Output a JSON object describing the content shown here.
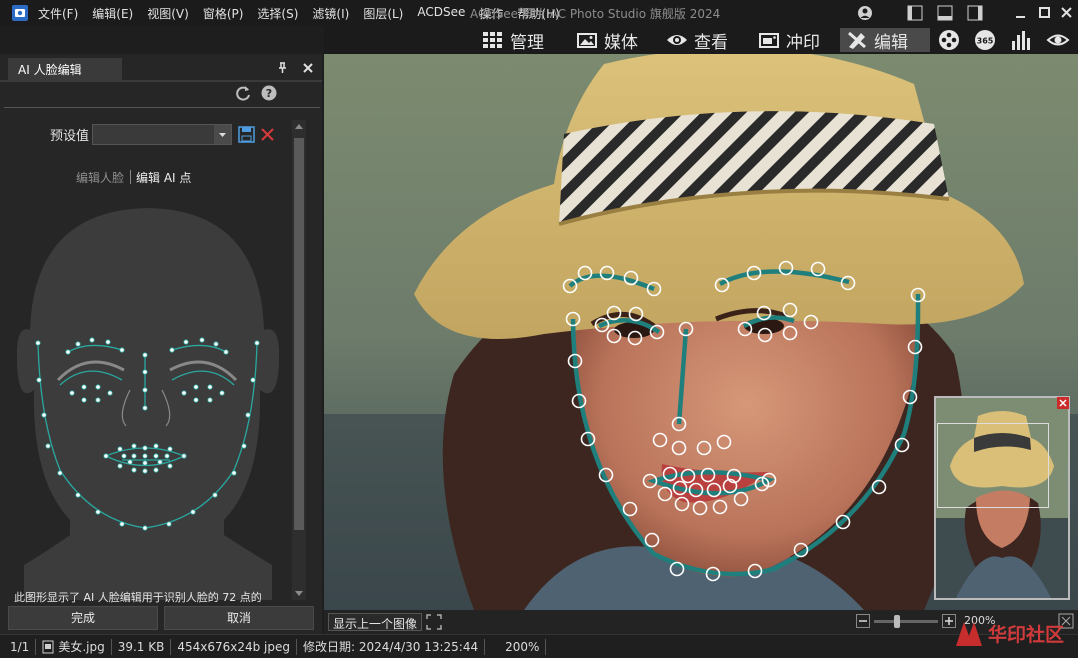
{
  "app": {
    "title": "ACDSee 照片 AC Photo Studio 旗舰版 2024",
    "menu": [
      "文件(F)",
      "编辑(E)",
      "视图(V)",
      "窗格(P)",
      "选择(S)",
      "滤镜(I)",
      "图层(L)",
      "ACDSee",
      "操作",
      "帮助(H)"
    ]
  },
  "modes": [
    {
      "label": "管理",
      "icon": "grid-icon"
    },
    {
      "label": "媒体",
      "icon": "photo-icon"
    },
    {
      "label": "查看",
      "icon": "eye-icon"
    },
    {
      "label": "冲印",
      "icon": "develop-icon"
    },
    {
      "label": "编辑",
      "icon": "edit-icon",
      "active": true
    }
  ],
  "panel": {
    "tab": "AI 人脸编辑",
    "preset_label": "预设值",
    "preset_value": "",
    "sub_tabs": [
      "编辑人脸",
      "编辑 AI 点"
    ],
    "info_text": "此图形显示了 AI 人脸编辑用于识别人脸的 72 点的",
    "done": "完成",
    "cancel": "取消"
  },
  "viewbar": {
    "show_prev": "显示上一个图像",
    "zoom": "200%"
  },
  "status": {
    "index": "1/1",
    "filename": "美女.jpg",
    "size": "39.1 KB",
    "dims": "454x676x24b jpeg",
    "modified": "修改日期: 2024/4/30 13:25:44",
    "zoom": "200%"
  },
  "watermark": "华印社区",
  "colors": {
    "accent": "#2a9d9a",
    "point": "#ffffff",
    "line": "#1f7f7c"
  }
}
